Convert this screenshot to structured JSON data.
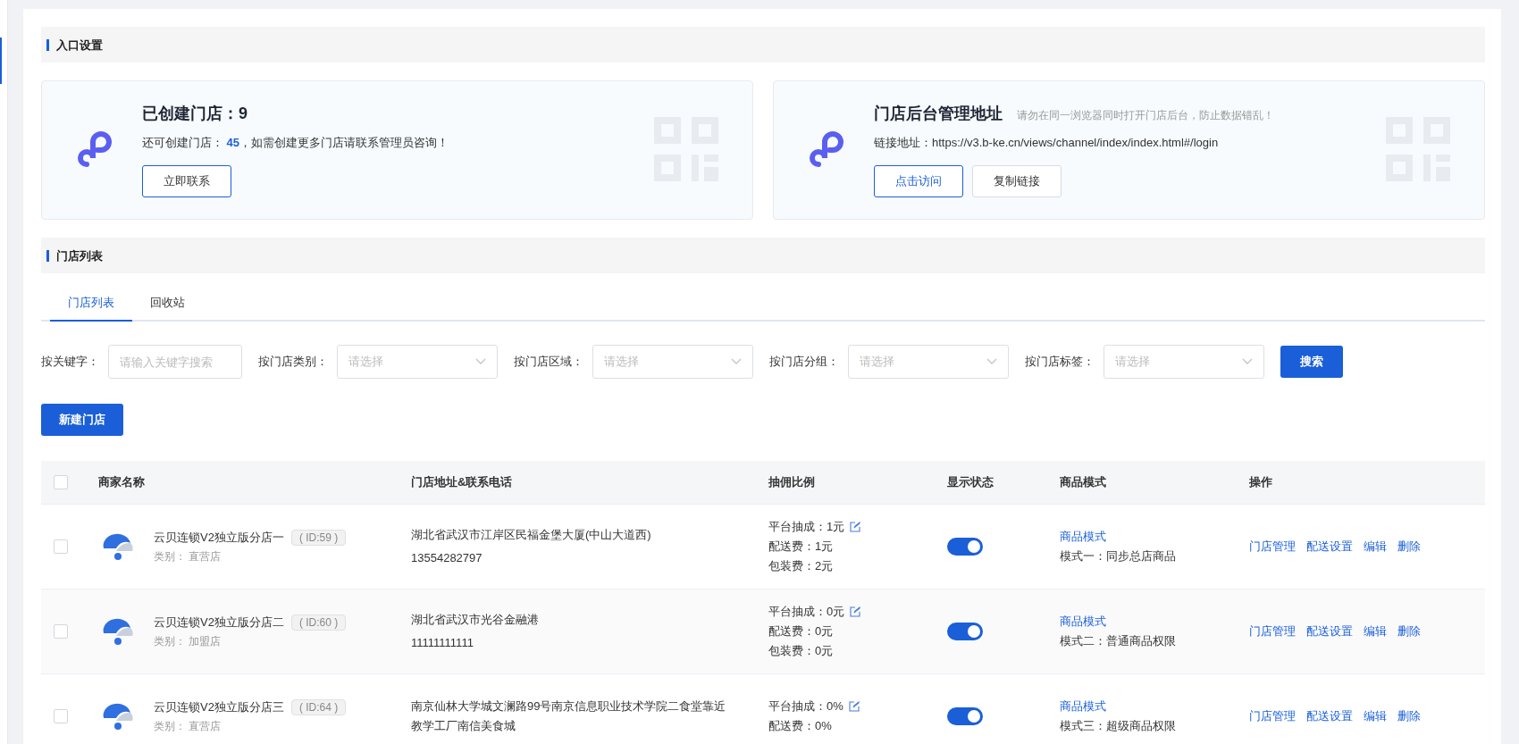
{
  "entry_section": {
    "title": "入口设置"
  },
  "cards": [
    {
      "title": "已创建门店：9",
      "text_prefix": "还可创建门店：",
      "text_count": "45",
      "text_suffix": "，如需创建更多门店请联系管理员咨询！",
      "buttons": [
        {
          "label": "立即联系",
          "primary": true
        }
      ]
    },
    {
      "title": "门店后台管理地址",
      "note": "请勿在同一浏览器同时打开门店后台，防止数据错乱！",
      "text_prefix": "链接地址：https://v3.b-ke.cn/views/channel/index/index.html#/login",
      "buttons": [
        {
          "label": "点击访问",
          "primary": true
        },
        {
          "label": "复制链接",
          "primary": false
        }
      ]
    }
  ],
  "list_section": {
    "title": "门店列表"
  },
  "tabs": [
    {
      "label": "门店列表",
      "selected": true
    },
    {
      "label": "回收站",
      "selected": false
    }
  ],
  "filters": [
    {
      "kind": "input",
      "label": "按关键字：",
      "placeholder": "请输入关键字搜索"
    },
    {
      "kind": "select",
      "label": "按门店类别：",
      "placeholder": "请选择"
    },
    {
      "kind": "select",
      "label": "按门店区域：",
      "placeholder": "请选择"
    },
    {
      "kind": "select",
      "label": "按门店分组：",
      "placeholder": "请选择"
    },
    {
      "kind": "select",
      "label": "按门店标签：",
      "placeholder": "请选择"
    }
  ],
  "search_button": "搜索",
  "new_button": "新建门店",
  "table": {
    "checked_all": false,
    "columns": [
      "商家名称",
      "门店地址&联系电话",
      "抽佣比例",
      "显示状态",
      "商品模式",
      "操作"
    ],
    "rows": [
      {
        "checked": false,
        "name": "云贝连锁V2独立版分店一",
        "id": "( ID:59 )",
        "category": "类别： 直营店",
        "address": "湖北省武汉市江岸区民福金堡大厦(中山大道西)",
        "phone": "13554282797",
        "fees": [
          "平台抽成：1元",
          "配送费：1元",
          "包装费：2元"
        ],
        "on": true,
        "mode_link": "商品模式",
        "mode": "模式一：同步总店商品",
        "actions": [
          "门店管理",
          "配送设置",
          "编辑",
          "删除"
        ]
      },
      {
        "checked": false,
        "name": "云贝连锁V2独立版分店二",
        "id": "( ID:60 )",
        "category": "类别： 加盟店",
        "address": "湖北省武汉市光谷金融港",
        "phone": "11111111111",
        "fees": [
          "平台抽成：0元",
          "配送费：0元",
          "包装费：0元"
        ],
        "on": true,
        "mode_link": "商品模式",
        "mode": "模式二：普通商品权限",
        "actions": [
          "门店管理",
          "配送设置",
          "编辑",
          "删除"
        ]
      },
      {
        "checked": false,
        "name": "云贝连锁V2独立版分店三",
        "id": "( ID:64 )",
        "category": "类别： 直营店",
        "address": "南京仙林大学城文澜路99号南京信息职业技术学院二食堂靠近教学工厂南信美食城",
        "fees": [
          "平台抽成：0%",
          "配送费：0%"
        ],
        "on": true,
        "mode_link": "商品模式",
        "mode": "模式三：超级商品权限",
        "actions": [
          "门店管理",
          "配送设置",
          "编辑",
          "删除"
        ]
      }
    ]
  }
}
